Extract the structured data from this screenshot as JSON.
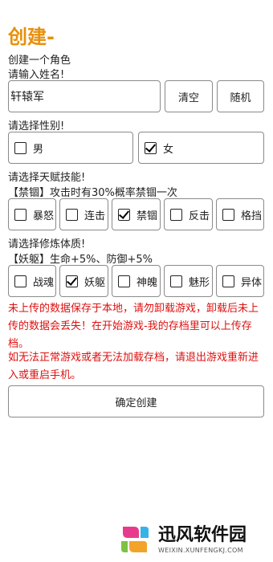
{
  "page": {
    "title": "创建-",
    "subtitle": "创建一个角色"
  },
  "name_section": {
    "prompt": "请输入姓名!",
    "value": "轩辕军",
    "clear_label": "清空",
    "random_label": "随机"
  },
  "gender_section": {
    "prompt": "请选择性别!",
    "options": [
      {
        "label": "男",
        "checked": false
      },
      {
        "label": "女",
        "checked": true
      }
    ]
  },
  "talent_section": {
    "prompt": "请选择天赋技能!",
    "description": "【禁锢】攻击时有30%概率禁锢一次",
    "options": [
      {
        "label": "暴怒",
        "checked": false
      },
      {
        "label": "连击",
        "checked": false
      },
      {
        "label": "禁锢",
        "checked": true
      },
      {
        "label": "反击",
        "checked": false
      },
      {
        "label": "格挡",
        "checked": false
      }
    ]
  },
  "constitution_section": {
    "prompt": "请选择修炼体质!",
    "description": "【妖躯】生命+5%、防御+5%",
    "options": [
      {
        "label": "战魂",
        "checked": false
      },
      {
        "label": "妖躯",
        "checked": true
      },
      {
        "label": "神魄",
        "checked": false
      },
      {
        "label": "魅形",
        "checked": false
      },
      {
        "label": "异体",
        "checked": false
      }
    ]
  },
  "warnings": {
    "line1": "未上传的数据保存于本地，请勿卸载游戏，卸载后未上传的数据会丢失！在开始游戏-我的存档里可以上传存档。",
    "line2": "如无法正常游戏或者无法加载存档，请退出游戏重新进入或重启手机。"
  },
  "confirm_label": "确定创建",
  "watermark": {
    "name": "迅风软件园",
    "url": "WEIXIN.XUNFENGKJ.COM"
  },
  "colors": {
    "title": "#e8900c",
    "warning": "#dd1111",
    "border": "#8a8a8a"
  }
}
